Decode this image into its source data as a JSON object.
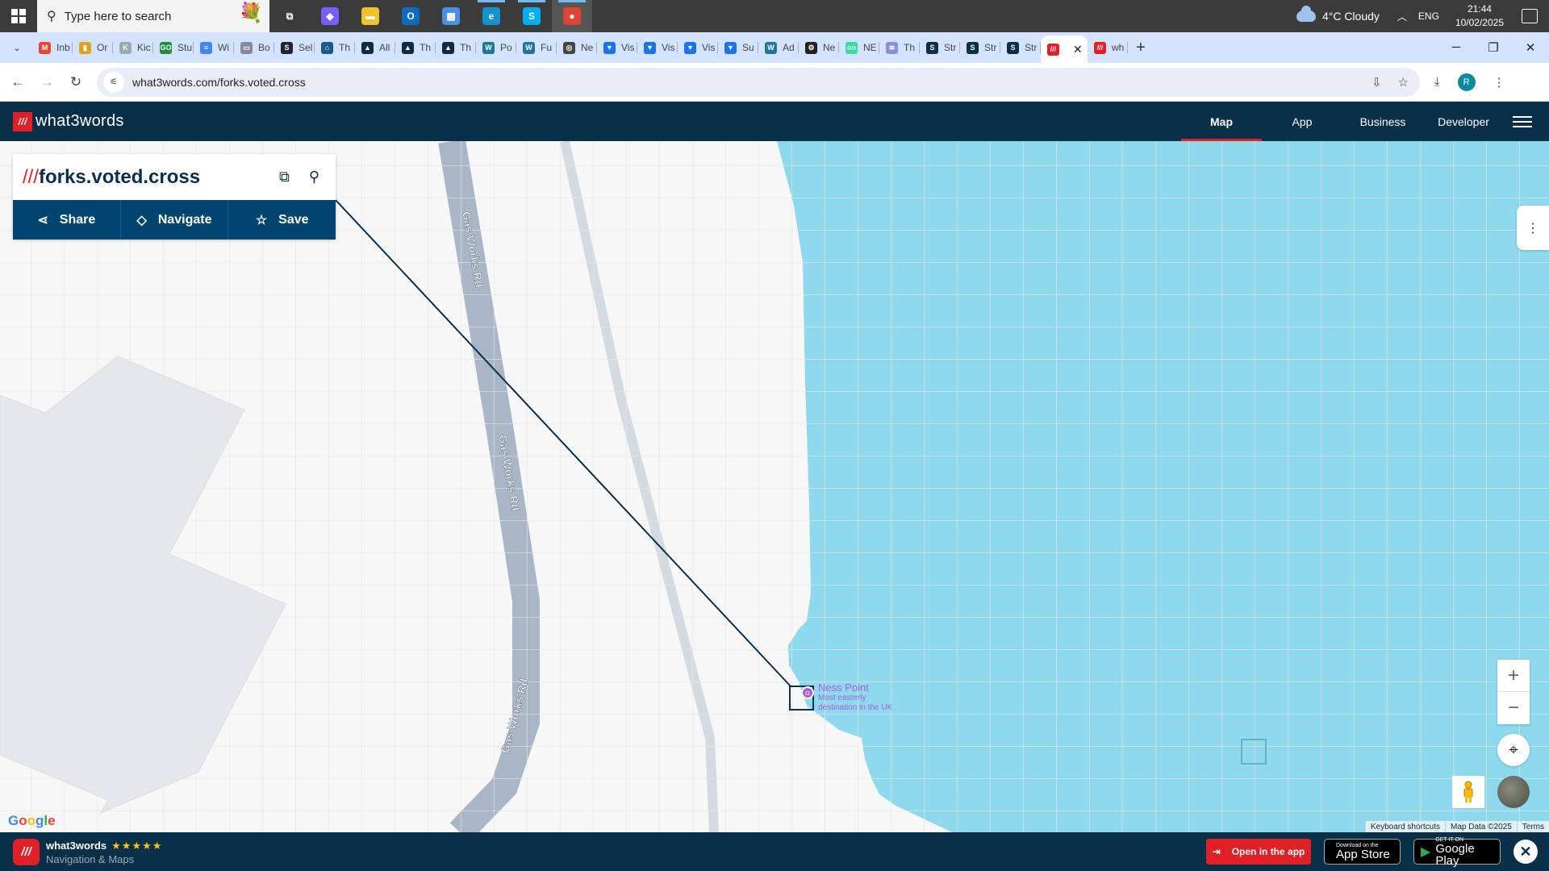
{
  "taskbar": {
    "search_placeholder": "Type here to search",
    "weather": "4°C  Cloudy",
    "language": "ENG",
    "time": "21:44",
    "date": "10/02/2025",
    "apps": [
      {
        "name": "task-view",
        "glyph": "⧉",
        "color": "#3b3b3b"
      },
      {
        "name": "copilot",
        "glyph": "◆",
        "color": "#7b5cff"
      },
      {
        "name": "file-explorer",
        "glyph": "▬",
        "color": "#f2c12e"
      },
      {
        "name": "outlook",
        "glyph": "O",
        "color": "#0f6cbd"
      },
      {
        "name": "microsoft-store",
        "glyph": "▦",
        "color": "#4a90e2"
      },
      {
        "name": "edge",
        "glyph": "e",
        "color": "#1592c9"
      },
      {
        "name": "skype",
        "glyph": "S",
        "color": "#00aff0"
      },
      {
        "name": "chrome",
        "glyph": "●",
        "color": "#db4437"
      }
    ]
  },
  "browser": {
    "tabs": [
      {
        "label": "Inb",
        "fav": "M",
        "color": "#ea4335"
      },
      {
        "label": "Or",
        "fav": "▮",
        "color": "#e0a020"
      },
      {
        "label": "Kic",
        "fav": "K",
        "color": "#9aa"
      },
      {
        "label": "Stu",
        "fav": "GO",
        "color": "#1e8e3e"
      },
      {
        "label": "Wi",
        "fav": "≡",
        "color": "#4285f4"
      },
      {
        "label": "Bo",
        "fav": "▭",
        "color": "#889"
      },
      {
        "label": "Sel",
        "fav": "S",
        "color": "#223"
      },
      {
        "label": "Th",
        "fav": "⌂",
        "color": "#1a5a8a"
      },
      {
        "label": "All",
        "fav": "▲",
        "color": "#102a43"
      },
      {
        "label": "Th",
        "fav": "▲",
        "color": "#102a43"
      },
      {
        "label": "Th",
        "fav": "▲",
        "color": "#102a43"
      },
      {
        "label": "Po",
        "fav": "W",
        "color": "#21759b"
      },
      {
        "label": "Fu",
        "fav": "W",
        "color": "#21759b"
      },
      {
        "label": "Ne",
        "fav": "◎",
        "color": "#444"
      },
      {
        "label": "Vis",
        "fav": "▼",
        "color": "#1a73e8"
      },
      {
        "label": "Vis",
        "fav": "▼",
        "color": "#1a73e8"
      },
      {
        "label": "Vis",
        "fav": "▼",
        "color": "#1a73e8"
      },
      {
        "label": "Su",
        "fav": "▼",
        "color": "#1a73e8"
      },
      {
        "label": "Ad",
        "fav": "W",
        "color": "#21759b"
      },
      {
        "label": "Ne",
        "fav": "⚙",
        "color": "#222"
      },
      {
        "label": "NE",
        "fav": "oo",
        "color": "#34e0a1"
      },
      {
        "label": "Th",
        "fav": "≋",
        "color": "#8a8fd8"
      },
      {
        "label": "Str",
        "fav": "S",
        "color": "#0a3049"
      },
      {
        "label": "Str",
        "fav": "S",
        "color": "#0a3049"
      },
      {
        "label": "Str",
        "fav": "S",
        "color": "#0a3049"
      }
    ],
    "active_tab": {
      "fav": "///",
      "color": "#e11f26"
    },
    "after_tab": {
      "label": "wh",
      "fav": "///",
      "color": "#e11f26"
    },
    "url": "what3words.com/forks.voted.cross",
    "profile_initial": "R"
  },
  "site": {
    "brand": "what3words",
    "nav": [
      {
        "label": "Map",
        "active": true
      },
      {
        "label": "App",
        "active": false
      },
      {
        "label": "Business",
        "active": false
      },
      {
        "label": "Developer",
        "active": false
      }
    ]
  },
  "address_card": {
    "slashes": "///",
    "address": "forks.voted.cross",
    "actions": {
      "share": "Share",
      "navigate": "Navigate",
      "save": "Save"
    }
  },
  "map": {
    "roads": [
      {
        "name": "Gas Works Rd"
      },
      {
        "name": "Gas Works Rd"
      },
      {
        "name": "Gas Works Rd"
      }
    ],
    "poi": {
      "title": "Ness Point",
      "subtitle_line1": "Most easterly",
      "subtitle_line2": "destination in the UK",
      "color": "#a55ee0"
    },
    "water_color": "#8ed9ed",
    "google_label": "Google",
    "attribution": [
      "Keyboard shortcuts",
      "Map Data ©2025",
      "Terms"
    ]
  },
  "app_banner": {
    "app_name": "what3words",
    "stars": "★★★★★",
    "category": "Navigation & Maps",
    "open_label": "Open in the app",
    "app_store_small": "Download on the",
    "app_store_big": "App Store",
    "google_play_small": "GET IT ON",
    "google_play_big": "Google Play"
  }
}
